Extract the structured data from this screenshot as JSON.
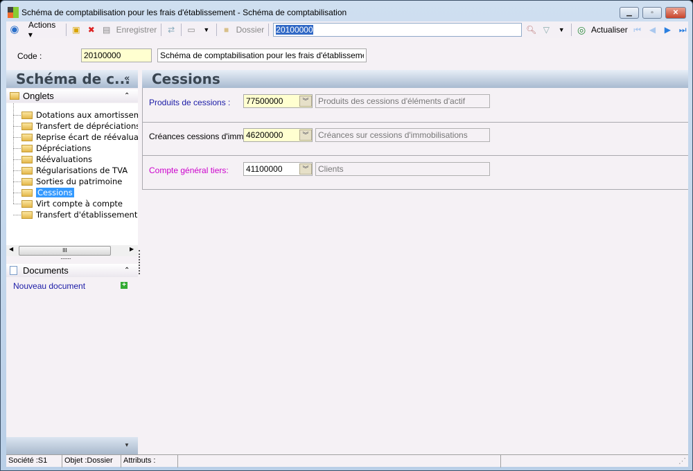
{
  "window": {
    "title": "Schéma de comptabilisation pour les frais d'établissement -  Schéma de comptabilisation"
  },
  "toolbar": {
    "actions": "Actions",
    "save": "Enregistrer",
    "folder": "Dossier",
    "search_value": "20100000",
    "refresh": "Actualiser"
  },
  "form": {
    "code_label": "Code :",
    "code_value": "20100000",
    "code_desc": "Schéma de comptabilisation pour les frais d'établissement"
  },
  "left": {
    "title": "Schéma de c...",
    "collapse": "«",
    "tabs_header": "Onglets",
    "tree": [
      "Dotations aux amortissements",
      "Transfert de dépréciations",
      "Reprise écart de réévaluation",
      "Dépréciations",
      "Réévaluations",
      "Régularisations de TVA",
      "Sorties du patrimoine",
      "Cessions",
      "Virt compte à compte",
      "Transfert d'établissement"
    ],
    "docs_header": "Documents",
    "new_doc": "Nouveau document"
  },
  "main": {
    "title": "Cessions",
    "fields": [
      {
        "label": "Produits de cessions :",
        "value": "77500000",
        "desc": "Produits des cessions d'éléments d'actif",
        "color": "#1a1aa6"
      },
      {
        "label": "Créances cessions d'immo :",
        "value": "46200000",
        "desc": "Créances sur cessions d'immobilisations",
        "color": "#000000"
      },
      {
        "label": "Compte général tiers:",
        "value": "41100000",
        "desc": "Clients",
        "color": "#cc00cc"
      }
    ]
  },
  "status": {
    "company": "Société :S1",
    "object": "Objet :Dossier",
    "attributes": "Attributs :"
  }
}
